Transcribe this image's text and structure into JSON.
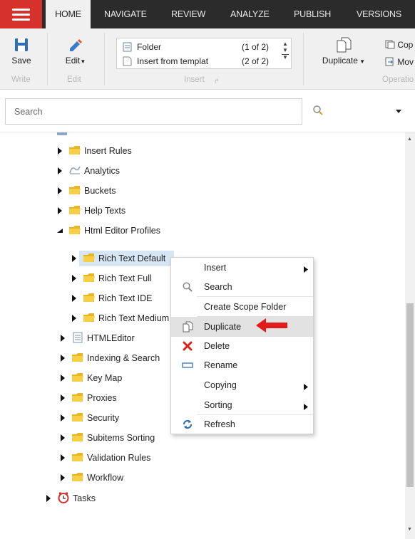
{
  "tabs": [
    {
      "label": "HOME",
      "active": true
    },
    {
      "label": "NAVIGATE",
      "active": false
    },
    {
      "label": "REVIEW",
      "active": false
    },
    {
      "label": "ANALYZE",
      "active": false
    },
    {
      "label": "PUBLISH",
      "active": false
    },
    {
      "label": "VERSIONS",
      "active": false
    }
  ],
  "ribbon": {
    "save_label": "Save",
    "write_group": "Write",
    "edit_label": "Edit",
    "edit_group": "Edit",
    "insert_items": [
      {
        "label": "Folder",
        "count": "(1 of 2)"
      },
      {
        "label": "Insert from templat",
        "count": "(2 of 2)"
      }
    ],
    "insert_group": "Insert",
    "duplicate_label": "Duplicate",
    "copy_label": "Cop",
    "move_label": "Mov",
    "operations_group": "Operatio"
  },
  "search": {
    "placeholder": "Search"
  },
  "tree": [
    {
      "label": "Insert Rules",
      "icon": "folder-icon"
    },
    {
      "label": "Analytics",
      "icon": "analytics-icon"
    },
    {
      "label": "Buckets",
      "icon": "folder-icon"
    },
    {
      "label": "Help Texts",
      "icon": "folder-icon"
    },
    {
      "label": "Html Editor Profiles",
      "icon": "folder-icon",
      "expanded": true
    },
    {
      "label": "Rich Text Default",
      "icon": "folder-icon",
      "selected": true
    },
    {
      "label": "Rich Text Full",
      "icon": "folder-icon"
    },
    {
      "label": "Rich Text IDE",
      "icon": "folder-icon"
    },
    {
      "label": "Rich Text Medium",
      "icon": "folder-icon"
    },
    {
      "label": "HTMLEditor",
      "icon": "document-icon"
    },
    {
      "label": "Indexing & Search",
      "icon": "folder-icon"
    },
    {
      "label": "Key Map",
      "icon": "folder-icon"
    },
    {
      "label": "Proxies",
      "icon": "folder-icon"
    },
    {
      "label": "Security",
      "icon": "folder-icon"
    },
    {
      "label": "Subitems Sorting",
      "icon": "folder-icon"
    },
    {
      "label": "Validation Rules",
      "icon": "folder-icon"
    },
    {
      "label": "Workflow",
      "icon": "folder-icon"
    },
    {
      "label": "Tasks",
      "icon": "clock-icon"
    }
  ],
  "context_menu": [
    {
      "label": "Insert",
      "icon": "",
      "submenu": true
    },
    {
      "label": "Search",
      "icon": "search-icon"
    },
    {
      "label": "Create Scope Folder",
      "icon": ""
    },
    {
      "label": "Duplicate",
      "icon": "duplicate-icon",
      "highlighted": true
    },
    {
      "label": "Delete",
      "icon": "delete-icon"
    },
    {
      "label": "Rename",
      "icon": "rename-icon"
    },
    {
      "label": "Copying",
      "icon": "",
      "submenu": true
    },
    {
      "label": "Sorting",
      "icon": "",
      "submenu": true
    },
    {
      "label": "Refresh",
      "icon": "refresh-icon"
    }
  ],
  "colors": {
    "accent": "#d6312b",
    "topbar": "#2b2b2b",
    "folder": "#f2c232",
    "selection": "#d6e6f4",
    "arrow": "#e01b1b"
  }
}
